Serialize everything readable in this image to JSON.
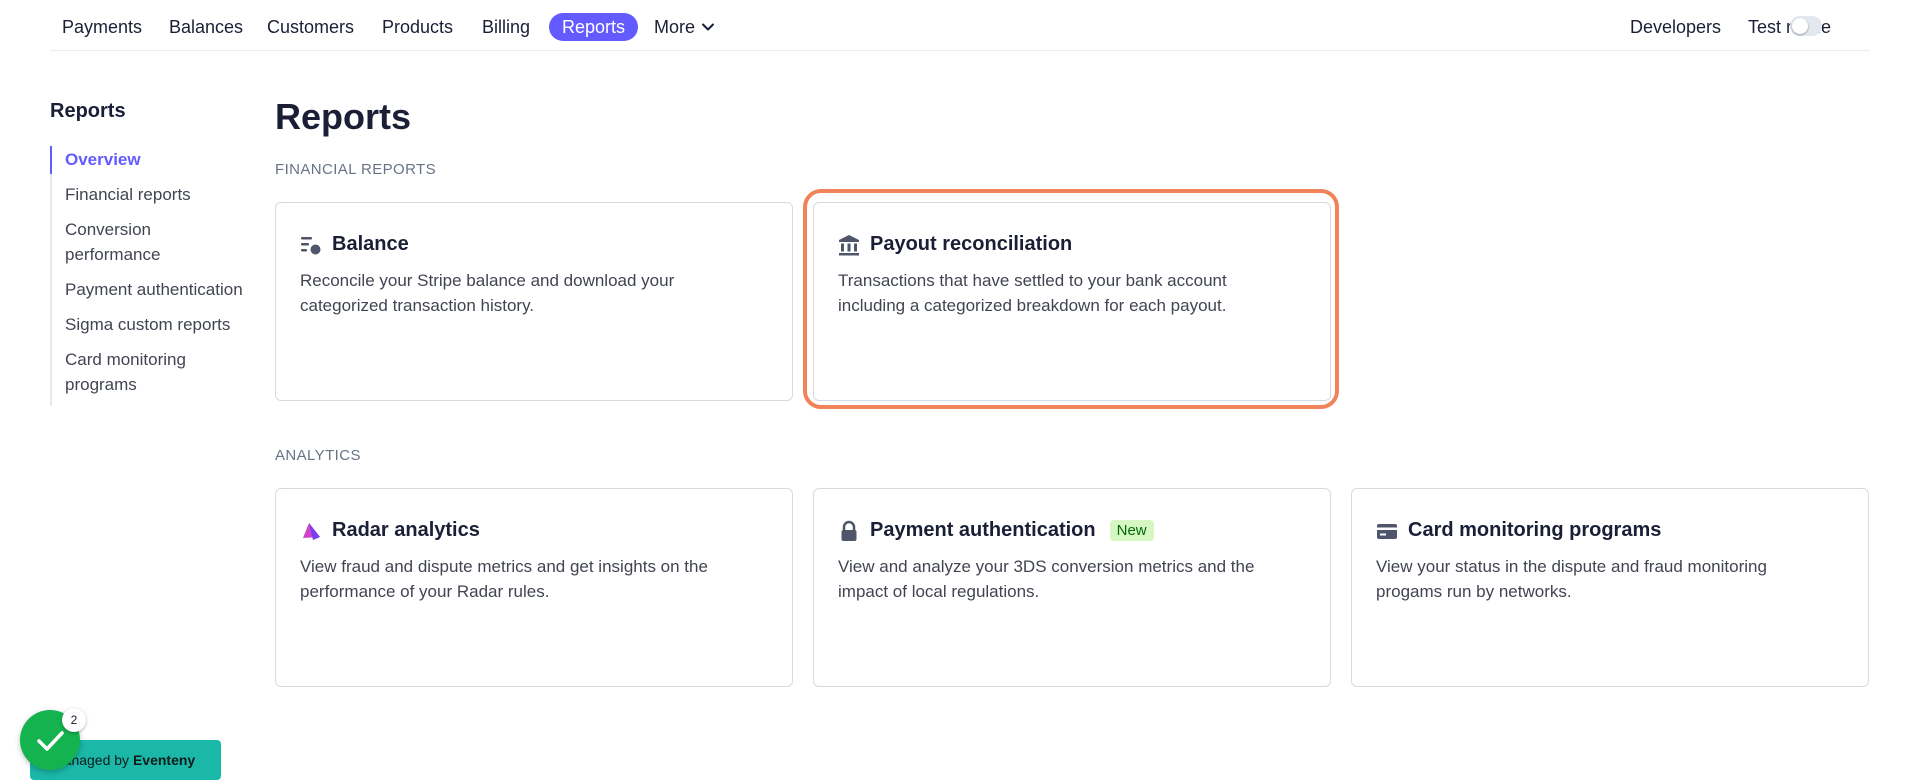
{
  "nav": {
    "items": [
      {
        "label": "Payments"
      },
      {
        "label": "Balances"
      },
      {
        "label": "Customers"
      },
      {
        "label": "Products"
      },
      {
        "label": "Billing"
      },
      {
        "label": "Reports",
        "active": true
      }
    ],
    "more_label": "More",
    "developers_label": "Developers",
    "test_mode_label": "Test mode",
    "test_mode_on": false
  },
  "sidebar": {
    "title": "Reports",
    "items": [
      {
        "label": "Overview",
        "active": true
      },
      {
        "label": "Financial reports"
      },
      {
        "label": "Conversion performance"
      },
      {
        "label": "Payment authentication"
      },
      {
        "label": "Sigma custom reports"
      },
      {
        "label": "Card monitoring programs"
      }
    ]
  },
  "main": {
    "title": "Reports",
    "financial": {
      "label": "FINANCIAL REPORTS",
      "cards": [
        {
          "title": "Balance",
          "icon": "balance-icon",
          "description": "Reconcile your Stripe balance and download your categorized transaction history."
        },
        {
          "title": "Payout reconciliation",
          "icon": "bank-icon",
          "description": "Transactions that have settled to your bank account including a categorized breakdown for each payout."
        }
      ]
    },
    "analytics": {
      "label": "ANALYTICS",
      "cards": [
        {
          "title": "Radar analytics",
          "icon": "radar-icon",
          "description": "View fraud and dispute metrics and get insights on the performance of your Radar rules."
        },
        {
          "title": "Payment authentication",
          "icon": "lock-icon",
          "badge": "New",
          "description": "View and analyze your 3DS conversion metrics and the impact of local regulations."
        },
        {
          "title": "Card monitoring programs",
          "icon": "card-icon",
          "description": "View your status in the dispute and fraud monitoring progams run by networks."
        }
      ]
    }
  },
  "widget": {
    "managed_prefix": "Managed by",
    "managed_brand": "Eventeny",
    "count": "2"
  },
  "colors": {
    "accent": "#635bff",
    "highlight": "#f0835a",
    "widget_bg": "#1bb8a8",
    "check": "#14b34f"
  }
}
